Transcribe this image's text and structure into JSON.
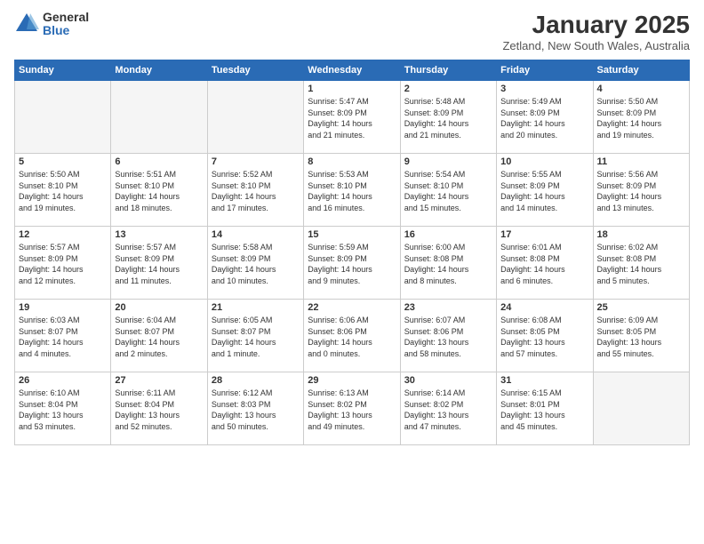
{
  "header": {
    "logo_general": "General",
    "logo_blue": "Blue",
    "title": "January 2025",
    "subtitle": "Zetland, New South Wales, Australia"
  },
  "weekdays": [
    "Sunday",
    "Monday",
    "Tuesday",
    "Wednesday",
    "Thursday",
    "Friday",
    "Saturday"
  ],
  "weeks": [
    [
      {
        "day": "",
        "info": ""
      },
      {
        "day": "",
        "info": ""
      },
      {
        "day": "",
        "info": ""
      },
      {
        "day": "1",
        "info": "Sunrise: 5:47 AM\nSunset: 8:09 PM\nDaylight: 14 hours\nand 21 minutes."
      },
      {
        "day": "2",
        "info": "Sunrise: 5:48 AM\nSunset: 8:09 PM\nDaylight: 14 hours\nand 21 minutes."
      },
      {
        "day": "3",
        "info": "Sunrise: 5:49 AM\nSunset: 8:09 PM\nDaylight: 14 hours\nand 20 minutes."
      },
      {
        "day": "4",
        "info": "Sunrise: 5:50 AM\nSunset: 8:09 PM\nDaylight: 14 hours\nand 19 minutes."
      }
    ],
    [
      {
        "day": "5",
        "info": "Sunrise: 5:50 AM\nSunset: 8:10 PM\nDaylight: 14 hours\nand 19 minutes."
      },
      {
        "day": "6",
        "info": "Sunrise: 5:51 AM\nSunset: 8:10 PM\nDaylight: 14 hours\nand 18 minutes."
      },
      {
        "day": "7",
        "info": "Sunrise: 5:52 AM\nSunset: 8:10 PM\nDaylight: 14 hours\nand 17 minutes."
      },
      {
        "day": "8",
        "info": "Sunrise: 5:53 AM\nSunset: 8:10 PM\nDaylight: 14 hours\nand 16 minutes."
      },
      {
        "day": "9",
        "info": "Sunrise: 5:54 AM\nSunset: 8:10 PM\nDaylight: 14 hours\nand 15 minutes."
      },
      {
        "day": "10",
        "info": "Sunrise: 5:55 AM\nSunset: 8:09 PM\nDaylight: 14 hours\nand 14 minutes."
      },
      {
        "day": "11",
        "info": "Sunrise: 5:56 AM\nSunset: 8:09 PM\nDaylight: 14 hours\nand 13 minutes."
      }
    ],
    [
      {
        "day": "12",
        "info": "Sunrise: 5:57 AM\nSunset: 8:09 PM\nDaylight: 14 hours\nand 12 minutes."
      },
      {
        "day": "13",
        "info": "Sunrise: 5:57 AM\nSunset: 8:09 PM\nDaylight: 14 hours\nand 11 minutes."
      },
      {
        "day": "14",
        "info": "Sunrise: 5:58 AM\nSunset: 8:09 PM\nDaylight: 14 hours\nand 10 minutes."
      },
      {
        "day": "15",
        "info": "Sunrise: 5:59 AM\nSunset: 8:09 PM\nDaylight: 14 hours\nand 9 minutes."
      },
      {
        "day": "16",
        "info": "Sunrise: 6:00 AM\nSunset: 8:08 PM\nDaylight: 14 hours\nand 8 minutes."
      },
      {
        "day": "17",
        "info": "Sunrise: 6:01 AM\nSunset: 8:08 PM\nDaylight: 14 hours\nand 6 minutes."
      },
      {
        "day": "18",
        "info": "Sunrise: 6:02 AM\nSunset: 8:08 PM\nDaylight: 14 hours\nand 5 minutes."
      }
    ],
    [
      {
        "day": "19",
        "info": "Sunrise: 6:03 AM\nSunset: 8:07 PM\nDaylight: 14 hours\nand 4 minutes."
      },
      {
        "day": "20",
        "info": "Sunrise: 6:04 AM\nSunset: 8:07 PM\nDaylight: 14 hours\nand 2 minutes."
      },
      {
        "day": "21",
        "info": "Sunrise: 6:05 AM\nSunset: 8:07 PM\nDaylight: 14 hours\nand 1 minute."
      },
      {
        "day": "22",
        "info": "Sunrise: 6:06 AM\nSunset: 8:06 PM\nDaylight: 14 hours\nand 0 minutes."
      },
      {
        "day": "23",
        "info": "Sunrise: 6:07 AM\nSunset: 8:06 PM\nDaylight: 13 hours\nand 58 minutes."
      },
      {
        "day": "24",
        "info": "Sunrise: 6:08 AM\nSunset: 8:05 PM\nDaylight: 13 hours\nand 57 minutes."
      },
      {
        "day": "25",
        "info": "Sunrise: 6:09 AM\nSunset: 8:05 PM\nDaylight: 13 hours\nand 55 minutes."
      }
    ],
    [
      {
        "day": "26",
        "info": "Sunrise: 6:10 AM\nSunset: 8:04 PM\nDaylight: 13 hours\nand 53 minutes."
      },
      {
        "day": "27",
        "info": "Sunrise: 6:11 AM\nSunset: 8:04 PM\nDaylight: 13 hours\nand 52 minutes."
      },
      {
        "day": "28",
        "info": "Sunrise: 6:12 AM\nSunset: 8:03 PM\nDaylight: 13 hours\nand 50 minutes."
      },
      {
        "day": "29",
        "info": "Sunrise: 6:13 AM\nSunset: 8:02 PM\nDaylight: 13 hours\nand 49 minutes."
      },
      {
        "day": "30",
        "info": "Sunrise: 6:14 AM\nSunset: 8:02 PM\nDaylight: 13 hours\nand 47 minutes."
      },
      {
        "day": "31",
        "info": "Sunrise: 6:15 AM\nSunset: 8:01 PM\nDaylight: 13 hours\nand 45 minutes."
      },
      {
        "day": "",
        "info": ""
      }
    ]
  ]
}
